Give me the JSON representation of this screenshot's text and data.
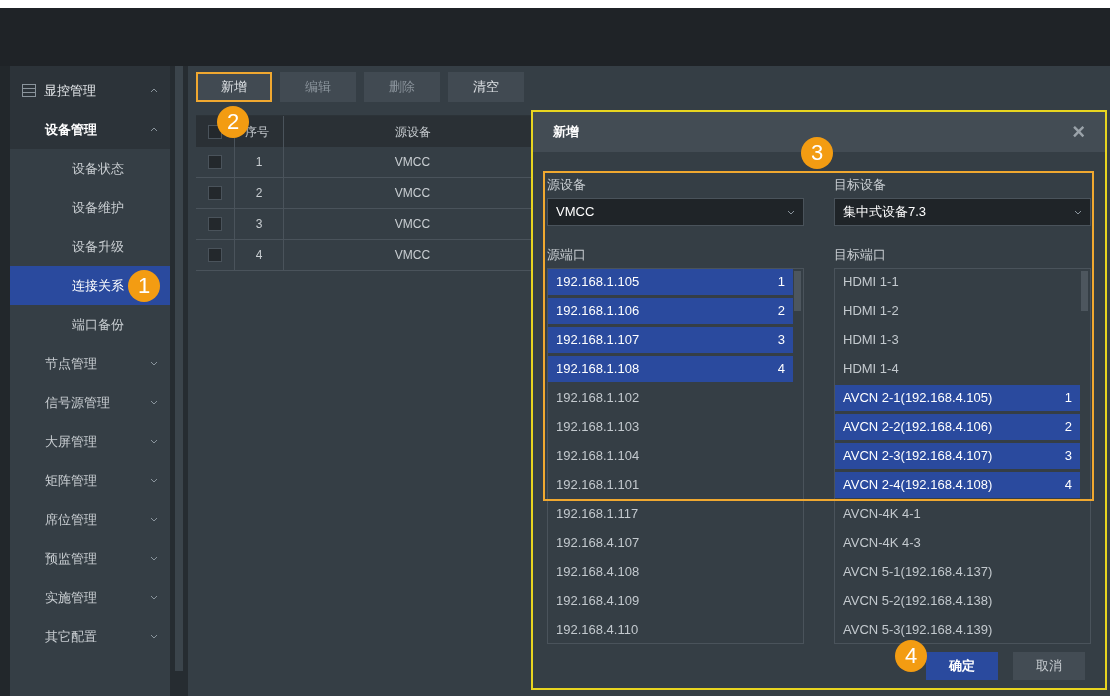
{
  "sidebar": {
    "items": [
      {
        "label": "显控管理",
        "expanded": true,
        "selected": false,
        "children": [
          {
            "label": "设备管理",
            "expanded": true,
            "selected": false,
            "children": [
              {
                "label": "设备状态",
                "selected": false
              },
              {
                "label": "设备维护",
                "selected": false
              },
              {
                "label": "设备升级",
                "selected": false
              },
              {
                "label": "连接关系",
                "selected": true
              },
              {
                "label": "端口备份",
                "selected": false
              }
            ]
          },
          {
            "label": "节点管理",
            "expanded": false,
            "selected": false
          },
          {
            "label": "信号源管理",
            "expanded": false,
            "selected": false
          },
          {
            "label": "大屏管理",
            "expanded": false,
            "selected": false
          },
          {
            "label": "矩阵管理",
            "expanded": false,
            "selected": false
          },
          {
            "label": "席位管理",
            "expanded": false,
            "selected": false
          },
          {
            "label": "预监管理",
            "expanded": false,
            "selected": false
          },
          {
            "label": "实施管理",
            "expanded": false,
            "selected": false
          },
          {
            "label": "其它配置",
            "expanded": false,
            "selected": false
          }
        ]
      }
    ]
  },
  "toolbar": [
    {
      "label": "新增",
      "disabled": false
    },
    {
      "label": "编辑",
      "disabled": true
    },
    {
      "label": "删除",
      "disabled": true
    },
    {
      "label": "清空",
      "disabled": false
    }
  ],
  "table": {
    "all_checked": false,
    "columns": [
      "序号",
      "源设备"
    ],
    "rows": [
      {
        "checked": false,
        "cells": [
          "1",
          "VMCC"
        ]
      },
      {
        "checked": false,
        "cells": [
          "2",
          "VMCC"
        ]
      },
      {
        "checked": false,
        "cells": [
          "3",
          "VMCC"
        ]
      },
      {
        "checked": false,
        "cells": [
          "4",
          "VMCC"
        ]
      }
    ]
  },
  "dialog": {
    "title": "新增",
    "close": "×",
    "source_device": {
      "label": "源设备",
      "value": "VMCC"
    },
    "target_device": {
      "label": "目标设备",
      "value": "集中式设备7.3"
    },
    "source_ports": {
      "label": "源端口",
      "items": [
        {
          "name": "192.168.1.105",
          "order": "1",
          "selected": true
        },
        {
          "name": "192.168.1.106",
          "order": "2",
          "selected": true
        },
        {
          "name": "192.168.1.107",
          "order": "3",
          "selected": true
        },
        {
          "name": "192.168.1.108",
          "order": "4",
          "selected": true
        },
        {
          "name": "192.168.1.102",
          "selected": false
        },
        {
          "name": "192.168.1.103",
          "selected": false
        },
        {
          "name": "192.168.1.104",
          "selected": false
        },
        {
          "name": "192.168.1.101",
          "selected": false
        },
        {
          "name": "192.168.1.117",
          "selected": false
        },
        {
          "name": "192.168.4.107",
          "selected": false
        },
        {
          "name": "192.168.4.108",
          "selected": false
        },
        {
          "name": "192.168.4.109",
          "selected": false
        },
        {
          "name": "192.168.4.110",
          "selected": false
        }
      ]
    },
    "target_ports": {
      "label": "目标端口",
      "items": [
        {
          "name": "HDMI 1-1",
          "selected": false
        },
        {
          "name": "HDMI 1-2",
          "selected": false
        },
        {
          "name": "HDMI 1-3",
          "selected": false
        },
        {
          "name": "HDMI 1-4",
          "selected": false
        },
        {
          "name": "AVCN 2-1(192.168.4.105)",
          "order": "1",
          "selected": true
        },
        {
          "name": "AVCN 2-2(192.168.4.106)",
          "order": "2",
          "selected": true
        },
        {
          "name": "AVCN 2-3(192.168.4.107)",
          "order": "3",
          "selected": true
        },
        {
          "name": "AVCN 2-4(192.168.4.108)",
          "order": "4",
          "selected": true
        },
        {
          "name": "AVCN-4K 4-1",
          "selected": false
        },
        {
          "name": "AVCN-4K 4-3",
          "selected": false
        },
        {
          "name": "AVCN 5-1(192.168.4.137)",
          "selected": false
        },
        {
          "name": "AVCN 5-2(192.168.4.138)",
          "selected": false
        },
        {
          "name": "AVCN 5-3(192.168.4.139)",
          "selected": false
        }
      ]
    },
    "buttons": [
      {
        "label": "确定",
        "kind": "primary"
      },
      {
        "label": "取消",
        "kind": "secondary"
      }
    ]
  },
  "annotations": [
    "1",
    "2",
    "3",
    "4"
  ]
}
